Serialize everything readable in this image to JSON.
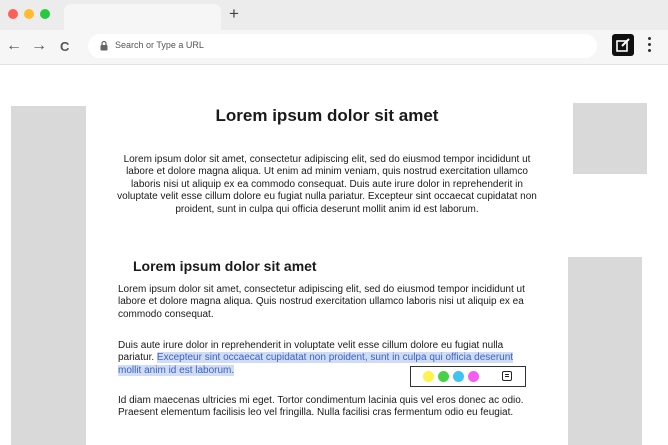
{
  "browser": {
    "new_tab_glyph": "+",
    "nav": {
      "back": "←",
      "forward": "→",
      "reload": "C"
    },
    "url_placeholder": "Search or Type a URL",
    "traffic_lights": [
      "#ff5f57",
      "#febc2e",
      "#28c840"
    ]
  },
  "article": {
    "title": "Lorem ipsum dolor sit amet",
    "intro": "Lorem ipsum dolor sit amet, consectetur adipiscing elit, sed do eiusmod tempor incididunt ut labore et dolore magna aliqua. Ut enim ad minim veniam, quis nostrud exercitation ullamco laboris nisi ut aliquip ex ea commodo consequat. Duis aute irure dolor in reprehenderit in voluptate velit esse cillum dolore eu fugiat nulla pariatur. Excepteur sint occaecat cupidatat non proident, sunt in culpa qui officia deserunt mollit anim id est laborum.",
    "subtitle": "Lorem ipsum dolor sit amet",
    "para1": "Lorem ipsum dolor sit amet, consectetur adipiscing elit, sed do eiusmod tempor incididunt ut labore et dolore magna aliqua. Quis nostrud exercitation ullamco laboris nisi ut aliquip ex ea commodo consequat.",
    "para2_before": "Duis aute irure dolor in reprehenderit in voluptate velit esse cillum dolore eu fugiat nulla pariatur. ",
    "para2_highlight": "Excepteur sint occaecat cupidatat non proident, sunt in culpa qui officia deserunt mollit anim id est laborum.",
    "para3": "Id diam maecenas ultricies mi eget. Tortor condimentum lacinia quis vel eros donec ac odio. Praesent elementum facilisis leo vel fringilla. Nulla facilisi cras fermentum odio eu feugiat."
  },
  "highlight_popup": {
    "colors": [
      "#fff24a",
      "#47d147",
      "#3fc3f0",
      "#f55cf0"
    ],
    "icon": "note-icon"
  }
}
